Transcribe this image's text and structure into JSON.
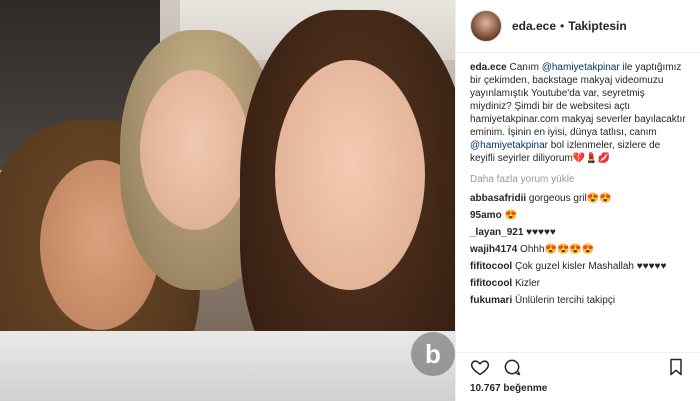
{
  "header": {
    "username": "eda.ece",
    "dot": "•",
    "follow_label": "Takiptesin"
  },
  "caption": {
    "username": "eda.ece",
    "part1": "Canım ",
    "mention1": "@hamiyetakpinar",
    "part2": " ile yaptığımız bir çekimden, backstage makyaj videomuzu yayınlamıştık Youtube'da var, seyretmiş miydiniz? Şimdi bir de websitesi açtı hamiyetakpinar.com makyaj severler bayılacaktır eminim. İşinin en iyisi, dünya tatlısı, canım ",
    "mention2": "@hamiyetakpinar",
    "part3": " bol izlenmeler, sizlere de keyifli seyirler diliyorum💔💄💋"
  },
  "more_comments_label": "Daha fazla yorum yükle",
  "comments": [
    {
      "user": "abbasafridii",
      "text": "gorgeous gril😍😍"
    },
    {
      "user": "95amo",
      "text": "😍"
    },
    {
      "user": "_layan_921",
      "text": "♥♥♥♥♥"
    },
    {
      "user": "wajih4174",
      "text": "Ohhh😍😍😍😍"
    },
    {
      "user": "fifitocool",
      "text": "Çok guzel kisler Mashallah ♥♥♥♥♥"
    },
    {
      "user": "fifitocool",
      "text": "Kizler"
    },
    {
      "user": "fukumari",
      "text": "Ünlülerin tercihi takipçi"
    }
  ],
  "likes_label": "10.767 beğenme",
  "watermark_text": "b"
}
